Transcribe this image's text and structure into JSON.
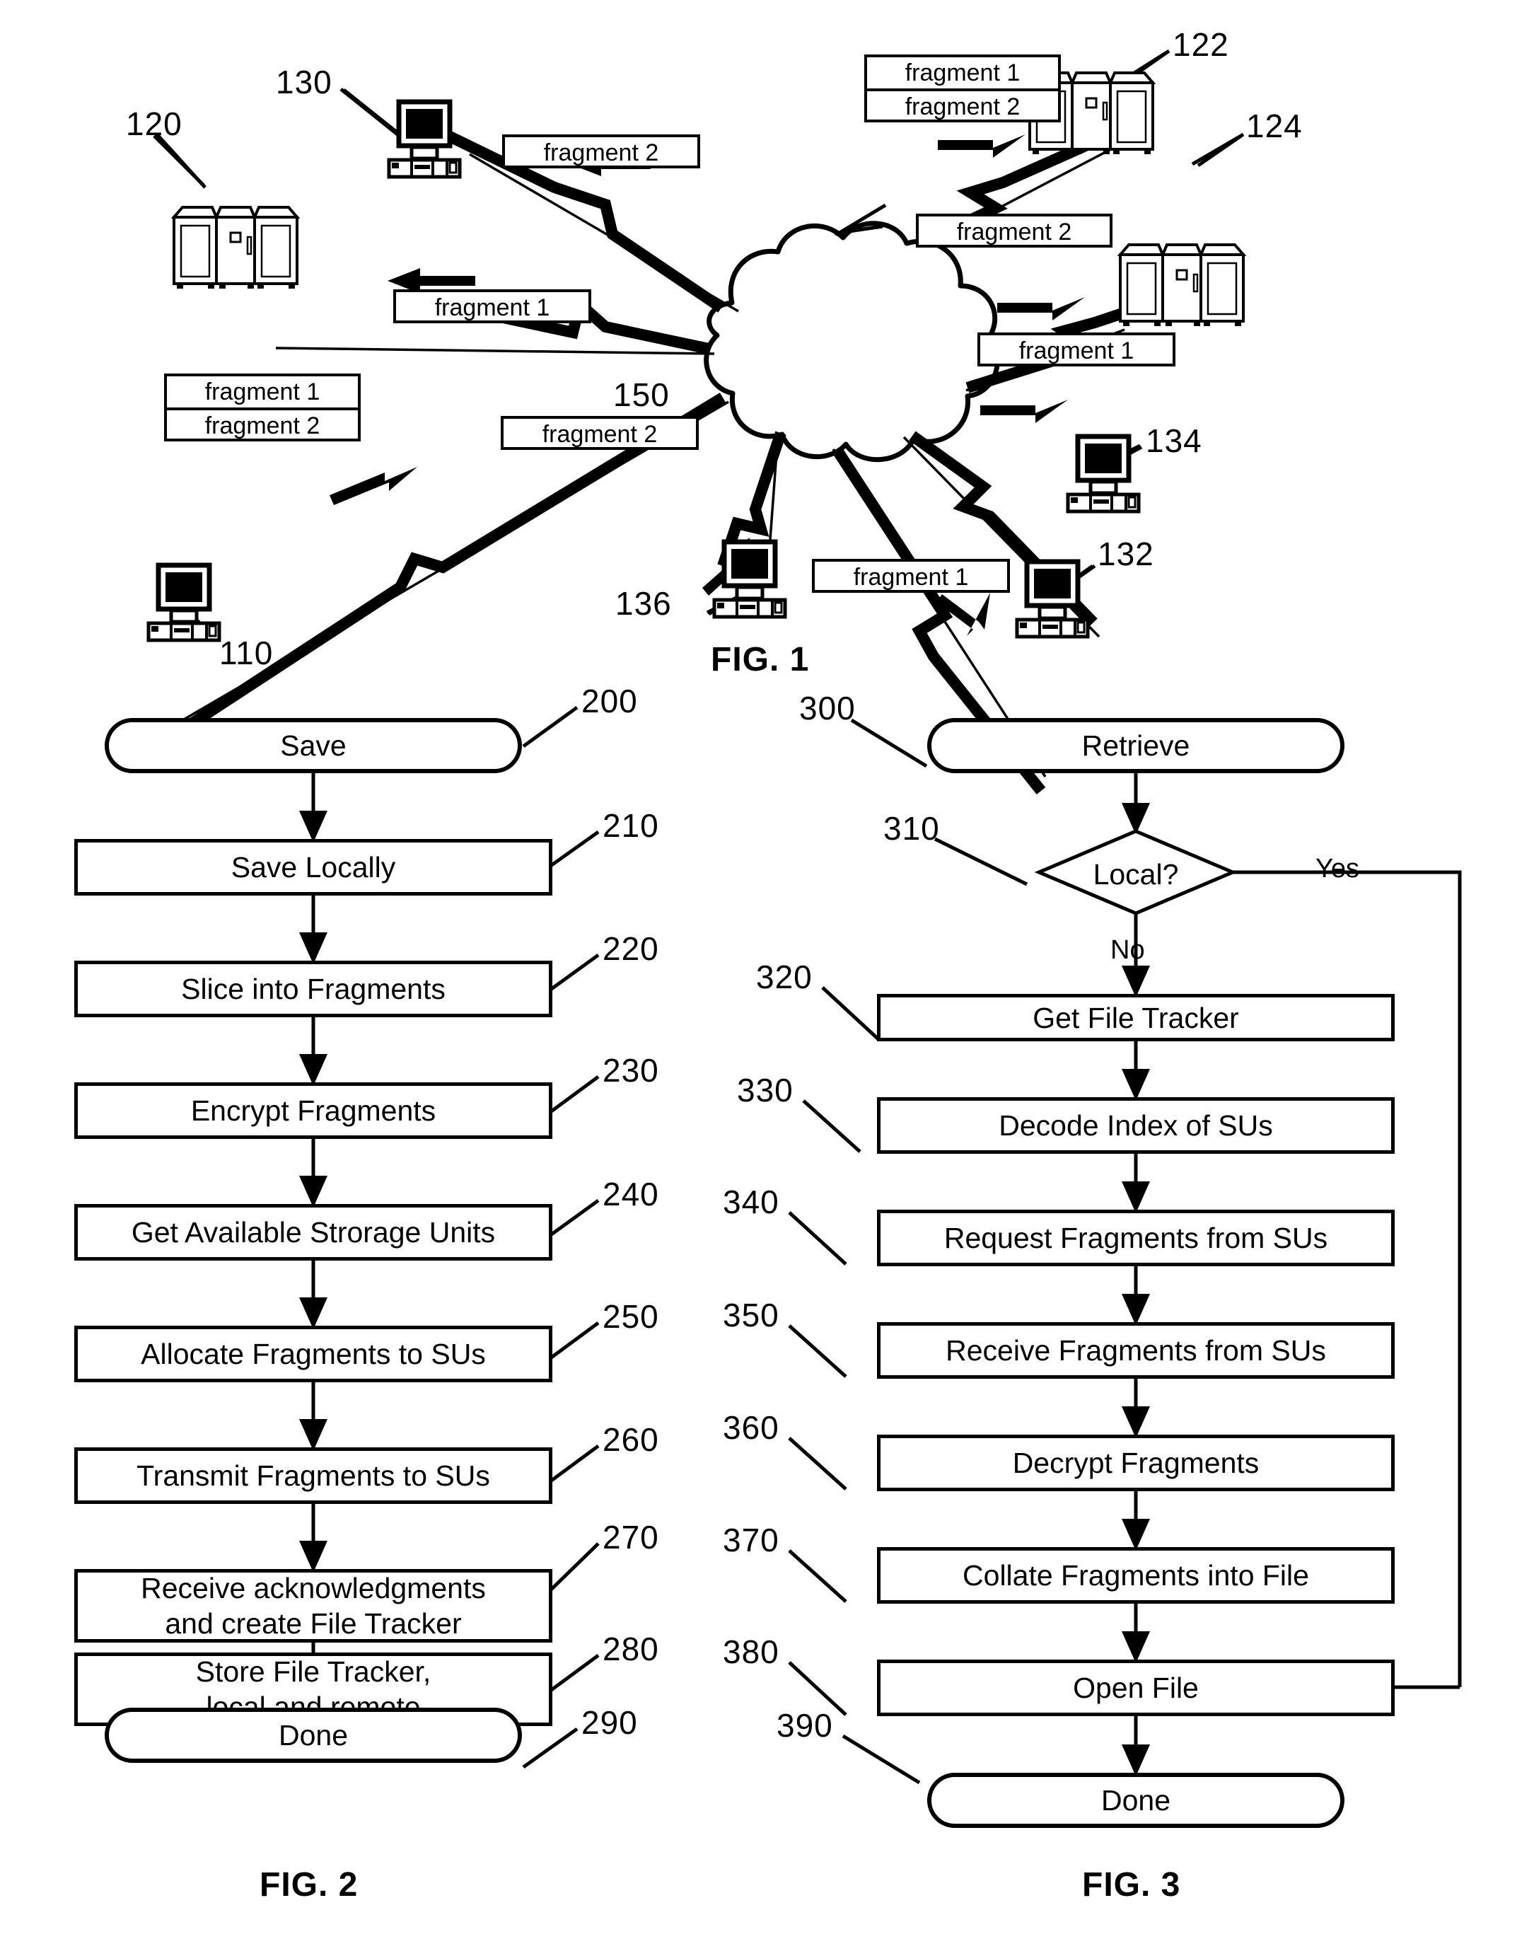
{
  "figures": [
    {
      "id": "fig1",
      "caption": "FIG. 1"
    },
    {
      "id": "fig2",
      "caption": "FIG. 2"
    },
    {
      "id": "fig3",
      "caption": "FIG. 3"
    }
  ],
  "fig1": {
    "caption": "FIG. 1",
    "nodes": [
      {
        "ref": "110",
        "type": "workstation",
        "label": "110"
      },
      {
        "ref": "120",
        "type": "storage-unit",
        "label": "120"
      },
      {
        "ref": "122",
        "type": "storage-unit",
        "label": "122"
      },
      {
        "ref": "124",
        "type": "storage-unit",
        "label": "124"
      },
      {
        "ref": "130",
        "type": "workstation",
        "label": "130"
      },
      {
        "ref": "132",
        "type": "workstation",
        "label": "132"
      },
      {
        "ref": "134",
        "type": "workstation",
        "label": "134"
      },
      {
        "ref": "136",
        "type": "workstation",
        "label": "136"
      },
      {
        "ref": "150",
        "type": "network-cloud",
        "label": "150"
      }
    ],
    "fragment_labels": [
      {
        "id": "frag-110",
        "rows": [
          "fragment 1",
          "fragment 2"
        ]
      },
      {
        "id": "frag-130",
        "rows": [
          "fragment 2"
        ]
      },
      {
        "id": "frag-120",
        "rows": [
          "fragment 1"
        ]
      },
      {
        "id": "frag-122",
        "rows": [
          "fragment 1",
          "fragment 2"
        ]
      },
      {
        "id": "frag-124",
        "rows": [
          "fragment 2"
        ]
      },
      {
        "id": "frag-134",
        "rows": [
          "fragment 1"
        ]
      },
      {
        "id": "frag-136",
        "rows": [
          "fragment 2"
        ]
      },
      {
        "id": "frag-132",
        "rows": [
          "fragment 1"
        ]
      }
    ],
    "text": {
      "fragment_1": "fragment 1",
      "fragment_2": "fragment 2",
      "ref_110": "110",
      "ref_120": "120",
      "ref_122": "122",
      "ref_124": "124",
      "ref_130": "130",
      "ref_132": "132",
      "ref_134": "134",
      "ref_136": "136",
      "ref_150": "150"
    }
  },
  "fig2": {
    "caption": "FIG. 2",
    "steps": [
      {
        "ref": "200",
        "label": "Save",
        "shape": "terminator"
      },
      {
        "ref": "210",
        "label": "Save Locally",
        "shape": "process"
      },
      {
        "ref": "220",
        "label": "Slice into Fragments",
        "shape": "process"
      },
      {
        "ref": "230",
        "label": "Encrypt Fragments",
        "shape": "process"
      },
      {
        "ref": "240",
        "label": "Get Available Strorage Units",
        "shape": "process"
      },
      {
        "ref": "250",
        "label": "Allocate Fragments to SUs",
        "shape": "process"
      },
      {
        "ref": "260",
        "label": "Transmit Fragments to SUs",
        "shape": "process"
      },
      {
        "ref": "270",
        "label": "Receive acknowledgments and create File Tracker",
        "shape": "process",
        "line1": "Receive acknowledgments",
        "line2": "and create File Tracker"
      },
      {
        "ref": "280",
        "label": "Store File Tracker, local and remote",
        "shape": "process",
        "line1": "Store File Tracker,",
        "line2": "local and remote"
      },
      {
        "ref": "290",
        "label": "Done",
        "shape": "terminator"
      }
    ]
  },
  "fig3": {
    "caption": "FIG. 3",
    "steps": [
      {
        "ref": "300",
        "label": "Retrieve",
        "shape": "terminator"
      },
      {
        "ref": "310",
        "label": "Local?",
        "shape": "decision",
        "yes": "Yes",
        "no": "No"
      },
      {
        "ref": "320",
        "label": "Get File Tracker",
        "shape": "process"
      },
      {
        "ref": "330",
        "label": "Decode Index of SUs",
        "shape": "process"
      },
      {
        "ref": "340",
        "label": "Request Fragments from SUs",
        "shape": "process"
      },
      {
        "ref": "350",
        "label": "Receive Fragments from SUs",
        "shape": "process"
      },
      {
        "ref": "360",
        "label": "Decrypt Fragments",
        "shape": "process"
      },
      {
        "ref": "370",
        "label": "Collate Fragments into File",
        "shape": "process"
      },
      {
        "ref": "380",
        "label": "Open File",
        "shape": "process"
      },
      {
        "ref": "390",
        "label": "Done",
        "shape": "terminator"
      }
    ],
    "branches": {
      "yes": "Yes",
      "no": "No"
    }
  },
  "colors": {
    "ink": "#000000",
    "paper": "#ffffff"
  }
}
